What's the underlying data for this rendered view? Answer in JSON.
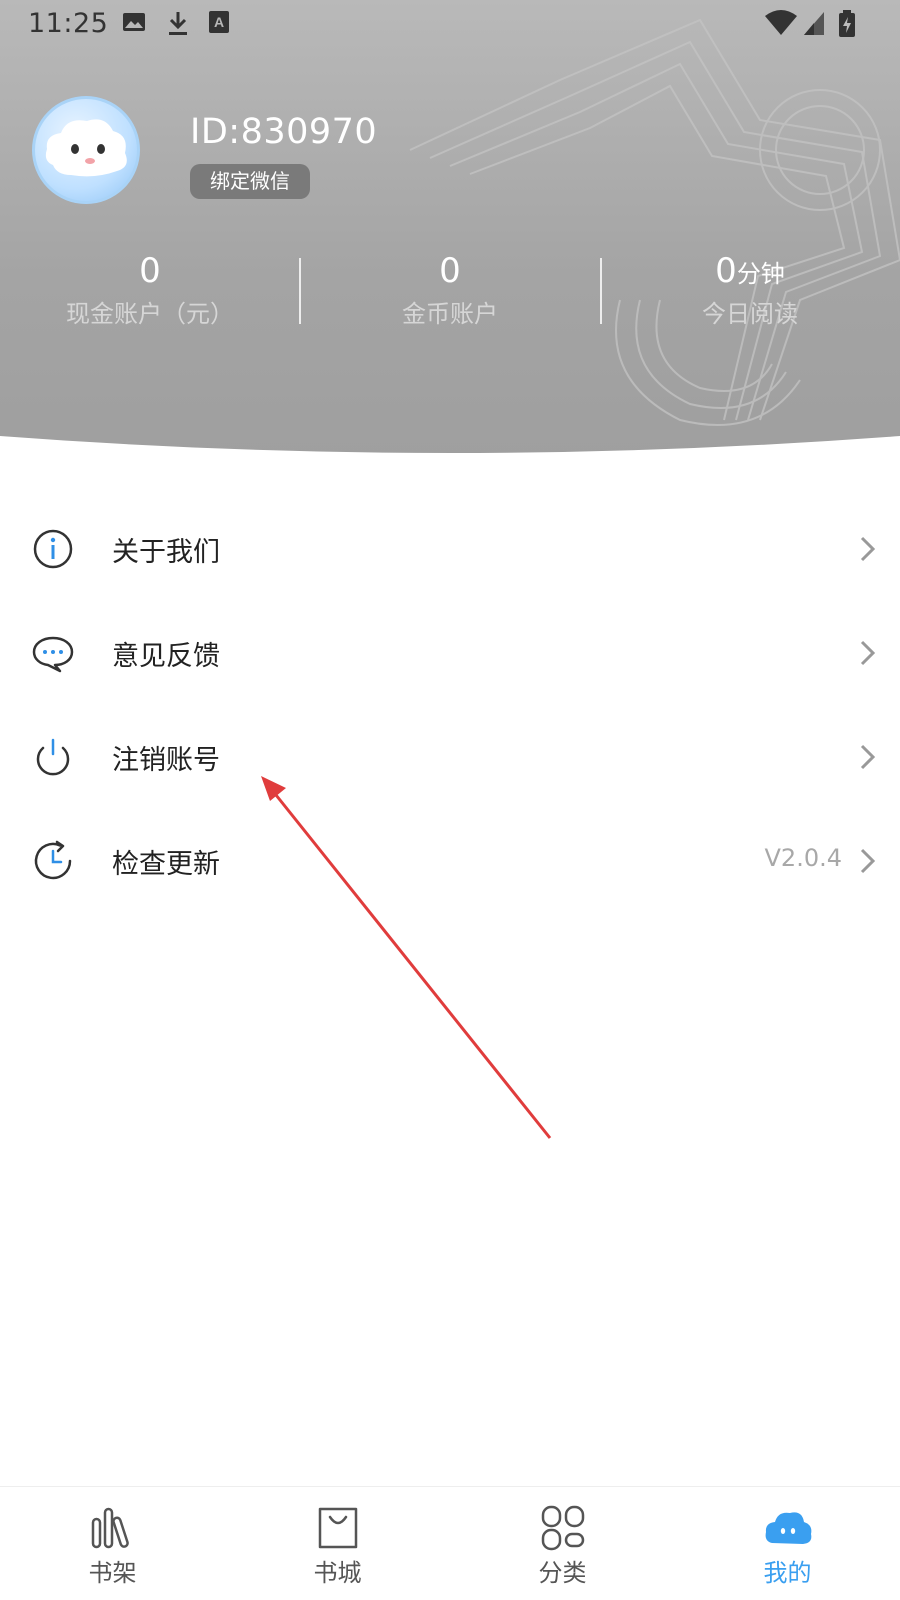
{
  "status_bar": {
    "time": "11:25"
  },
  "profile": {
    "user_id": "ID:830970",
    "bind_wechat_label": "绑定微信"
  },
  "stats": [
    {
      "value": "0",
      "unit": "",
      "label": "现金账户（元）"
    },
    {
      "value": "0",
      "unit": "",
      "label": "金币账户"
    },
    {
      "value": "0",
      "unit": "分钟",
      "label": "今日阅读"
    }
  ],
  "menu": [
    {
      "label": "关于我们",
      "value": "",
      "icon": "info-icon"
    },
    {
      "label": "意见反馈",
      "value": "",
      "icon": "chat-bubble-icon"
    },
    {
      "label": "注销账号",
      "value": "",
      "icon": "power-icon"
    },
    {
      "label": "检查更新",
      "value": "V2.0.4",
      "icon": "clock-refresh-icon"
    }
  ],
  "tabs": [
    {
      "label": "书架",
      "icon": "bookshelf-icon",
      "active": false
    },
    {
      "label": "书城",
      "icon": "shopping-bag-icon",
      "active": false
    },
    {
      "label": "分类",
      "icon": "category-grid-icon",
      "active": false
    },
    {
      "label": "我的",
      "icon": "cloud-face-icon",
      "active": true
    }
  ],
  "colors": {
    "accent": "#3a9ff0",
    "header_gray": "#a6a6a6",
    "annotation_arrow": "#e03c3c"
  }
}
